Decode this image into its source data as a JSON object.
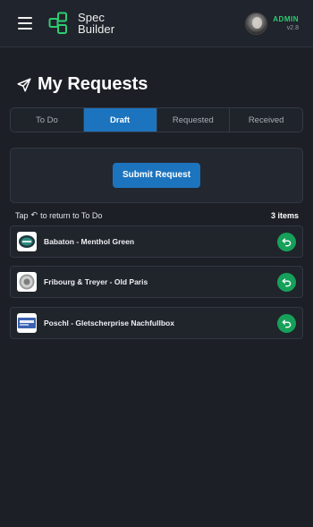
{
  "header": {
    "app_name_line1": "Spec",
    "app_name_line2": "Builder",
    "user_role": "ADMIN",
    "version": "v2.8"
  },
  "page": {
    "title": "My Requests"
  },
  "tabs": [
    {
      "label": "To Do",
      "active": false
    },
    {
      "label": "Draft",
      "active": true
    },
    {
      "label": "Requested",
      "active": false
    },
    {
      "label": "Received",
      "active": false
    }
  ],
  "submit_label": "Submit Request",
  "info": {
    "hint_prefix": "Tap",
    "hint_suffix": "to return to To Do",
    "count": "3 items"
  },
  "items": [
    {
      "name": "Babaton - Menthol Green",
      "thumb_icon": "tin-green-icon"
    },
    {
      "name": "Fribourg & Treyer - Old Paris",
      "thumb_icon": "tin-silver-icon"
    },
    {
      "name": "Poschl - Gletscherprise Nachfullbox",
      "thumb_icon": "box-blue-icon"
    }
  ],
  "colors": {
    "accent": "#1d74be",
    "success": "#16a05a",
    "role": "#2ecc71",
    "background": "#1c1f26"
  }
}
